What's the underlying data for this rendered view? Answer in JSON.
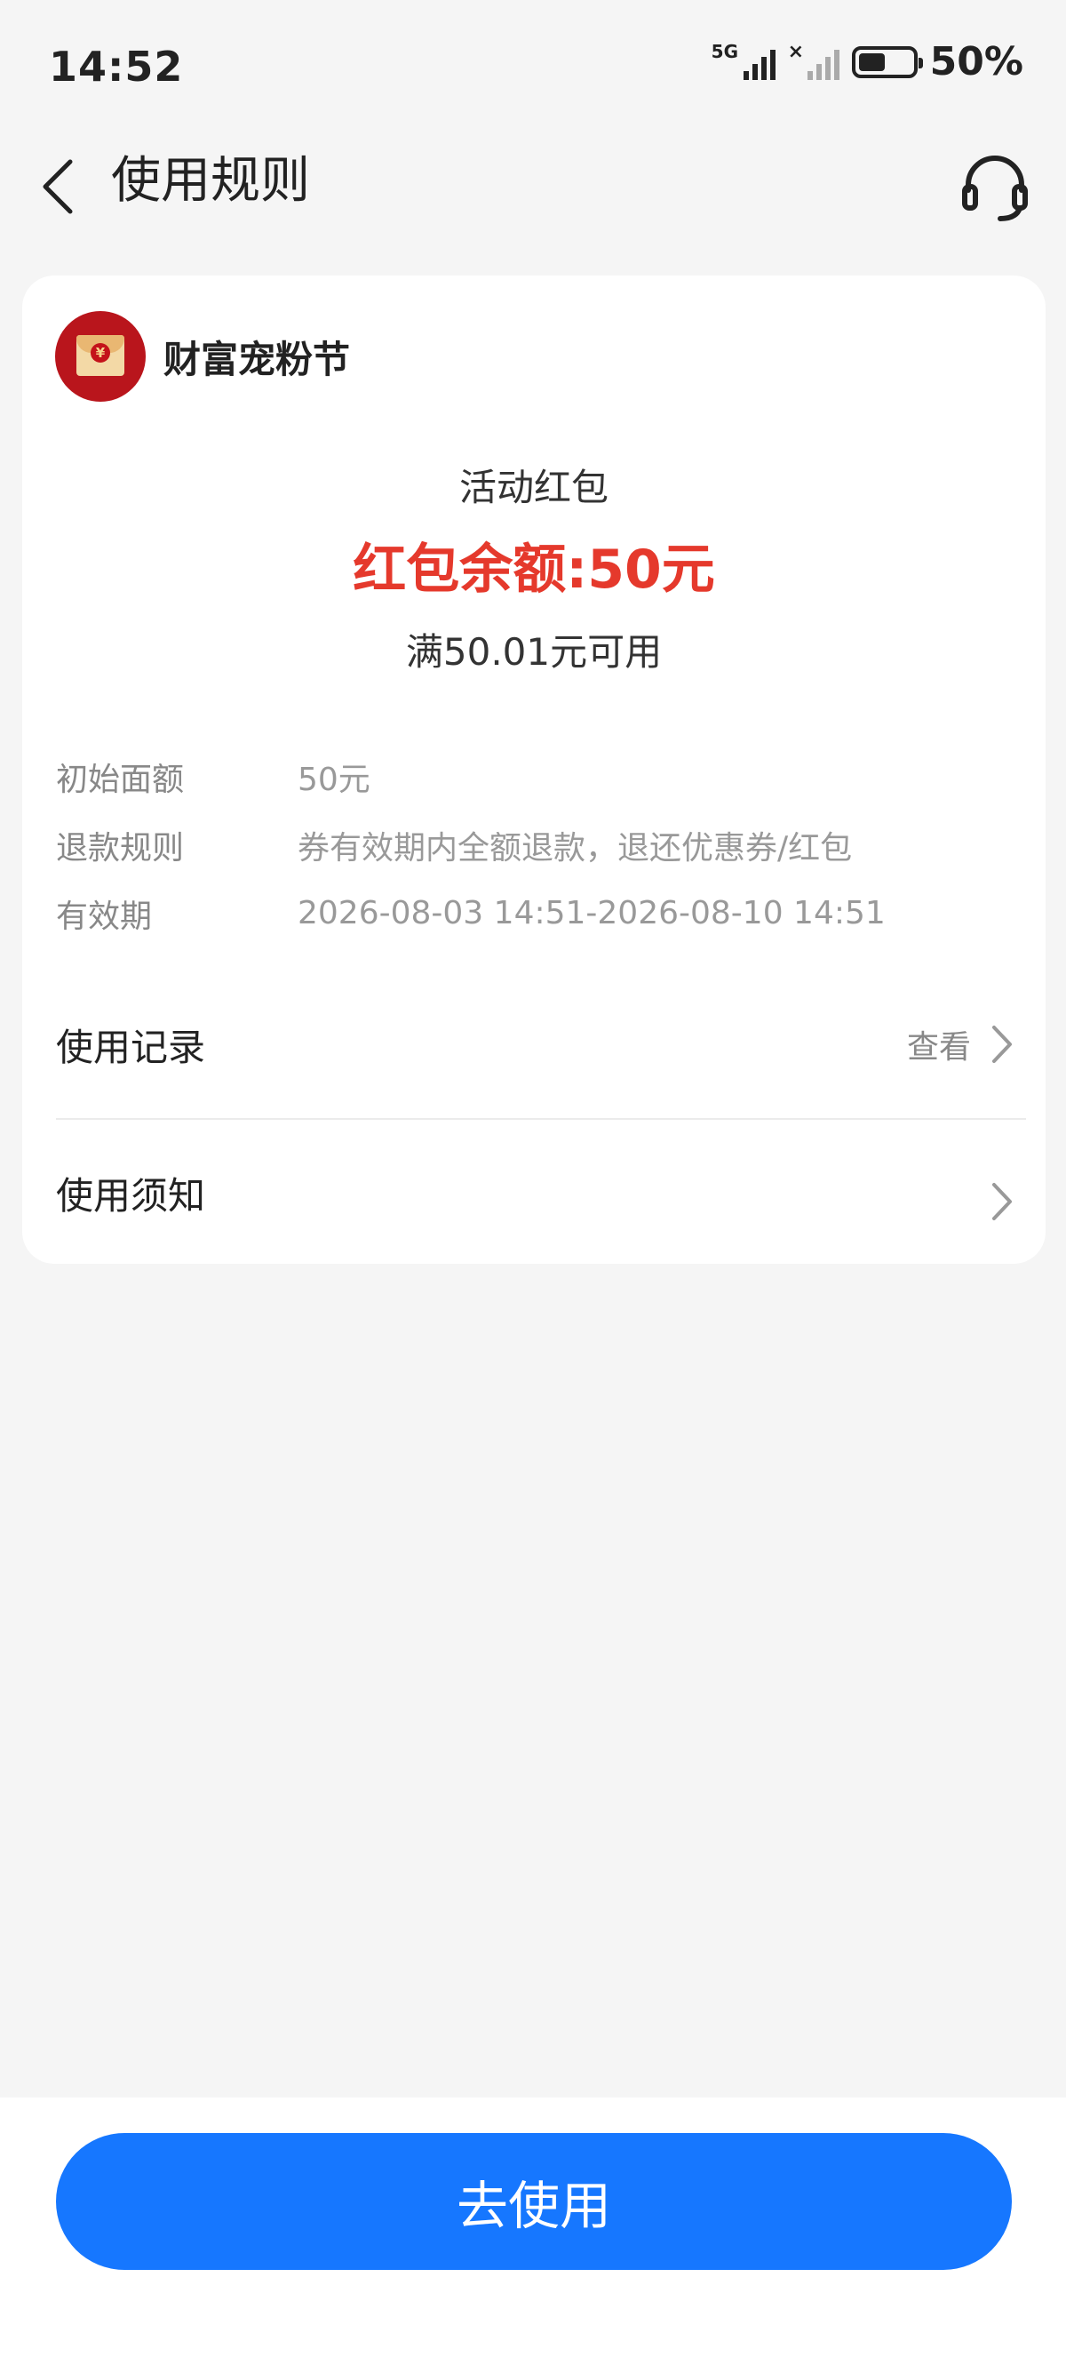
{
  "status_bar": {
    "time": "14:52",
    "network_label": "5G",
    "sim2_label": "×",
    "battery_level": 0.5,
    "battery_text": "50%"
  },
  "nav": {
    "back_icon": "chevron-left-icon",
    "title": "使用规则",
    "service_icon": "headset-icon"
  },
  "card": {
    "brand_name": "财富宠粉节",
    "brand_logo_icon": "red-envelope-icon",
    "packet_type": "活动红包",
    "balance_text": "红包余额:50元",
    "condition_text": "满50.01元可用",
    "info": [
      {
        "label": "初始面额",
        "value": "50元"
      },
      {
        "label": "退款规则",
        "value": "券有效期内全额退款，退还优惠券/红包"
      },
      {
        "label": "有效期",
        "value": "2026-08-03 14:51-2026-08-10 14:51"
      }
    ],
    "usage_record": {
      "label": "使用记录",
      "link": "查看"
    },
    "usage_notice": {
      "label": "使用须知"
    }
  },
  "bottom": {
    "button_label": "去使用"
  },
  "colors": {
    "accent": "#1677ff",
    "balance_red": "#e5392c",
    "page_bg": "#f5f5f5"
  }
}
